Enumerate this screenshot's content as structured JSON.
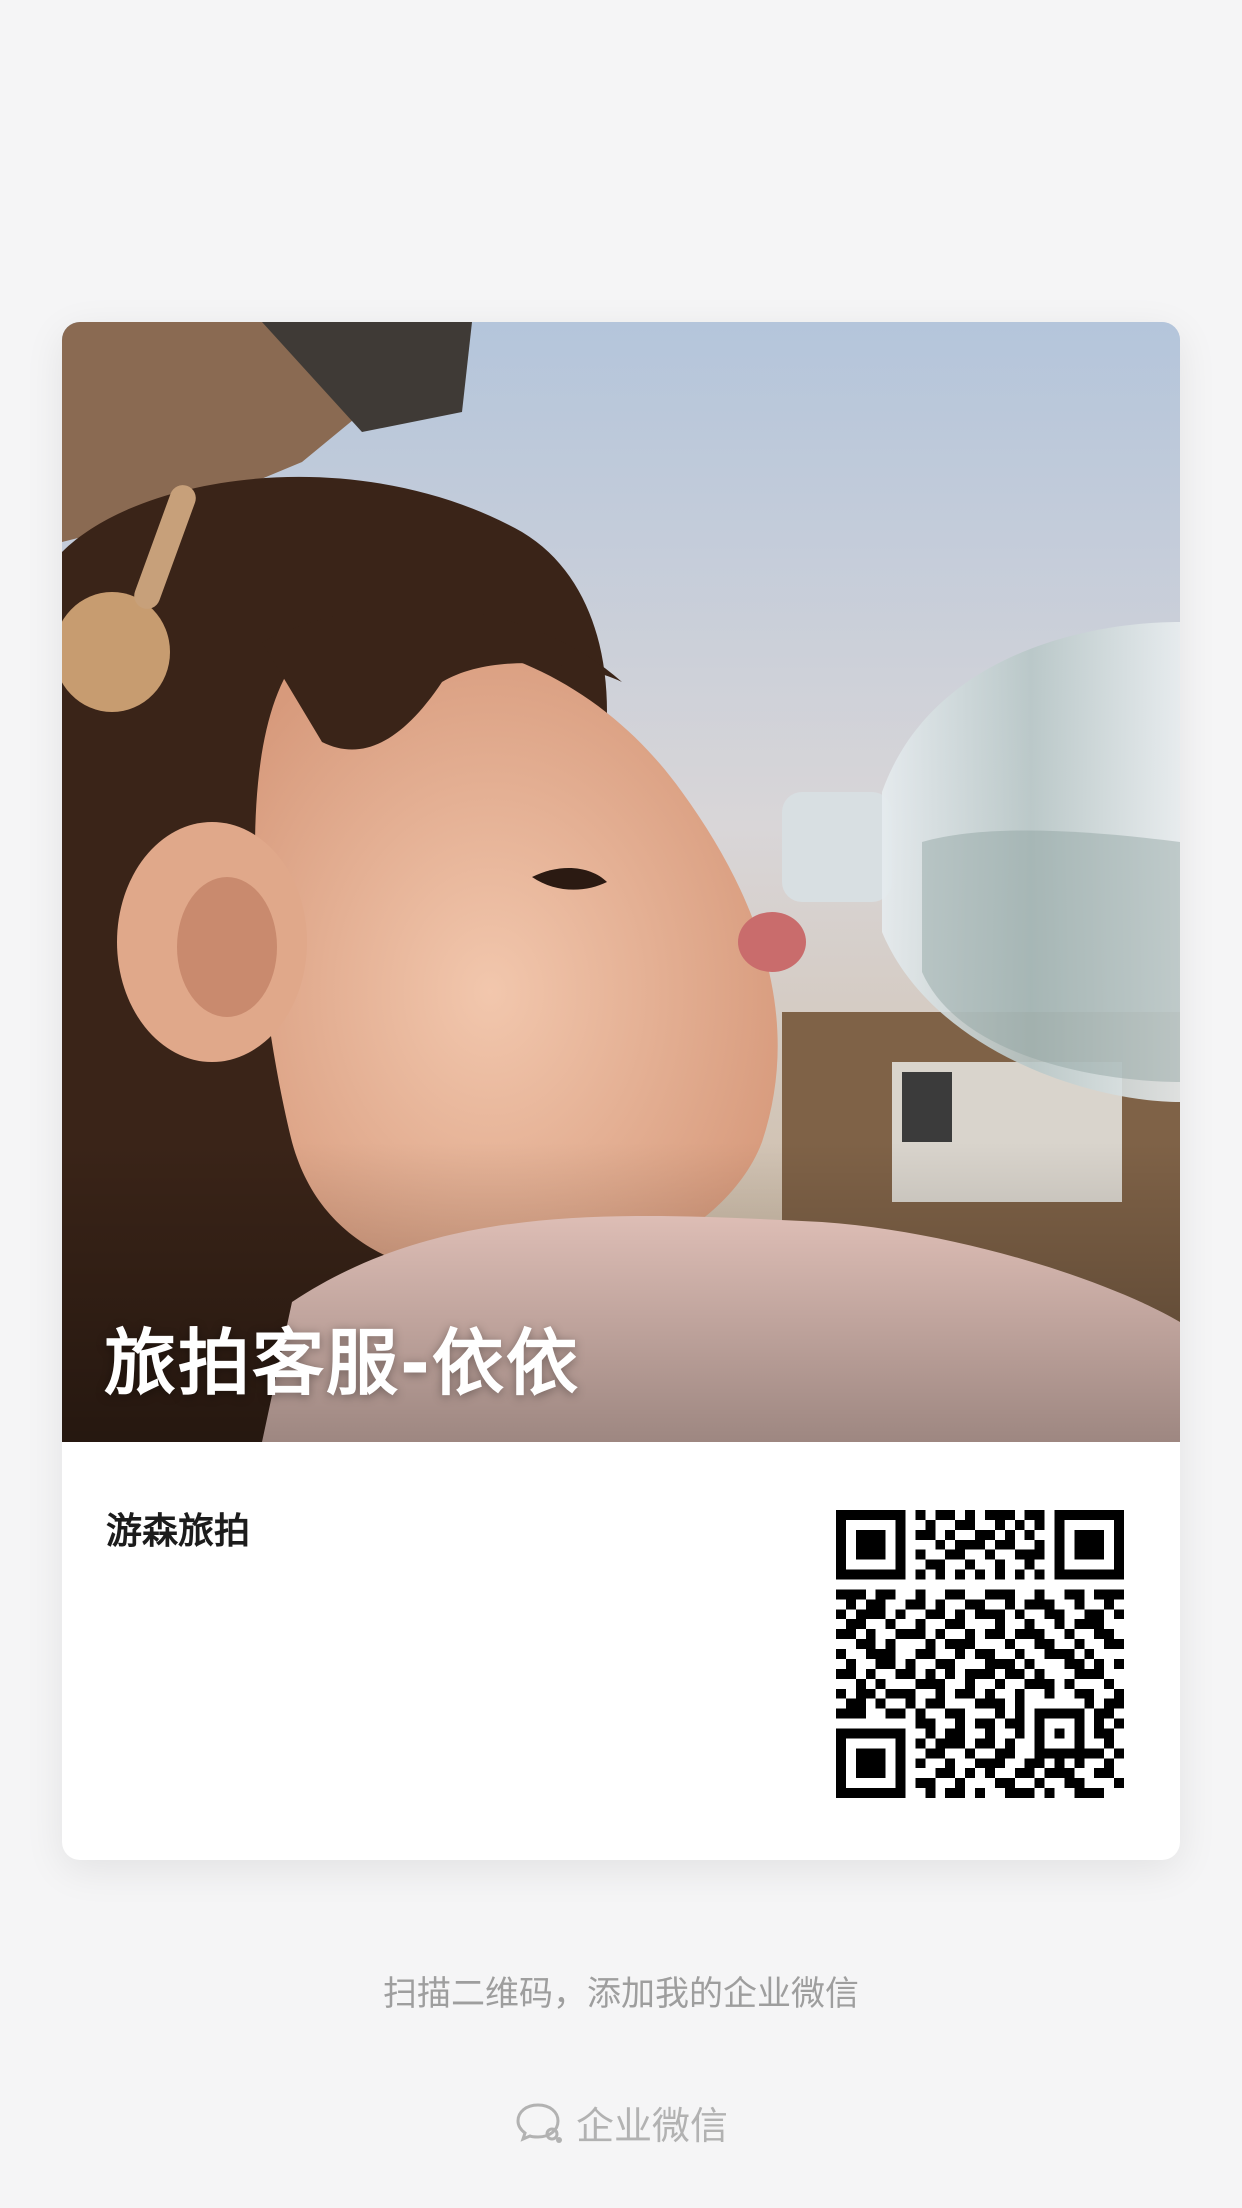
{
  "card": {
    "title": "旅拍客服-依依",
    "company": "游森旅拍"
  },
  "hint": "扫描二维码，添加我的企业微信",
  "brand": {
    "name": "企业微信",
    "icon": "wecom-icon"
  },
  "colors": {
    "background": "#f5f5f6",
    "card": "#ffffff",
    "hint_text": "#9e9e9e",
    "brand_text": "#b2b2b2"
  }
}
